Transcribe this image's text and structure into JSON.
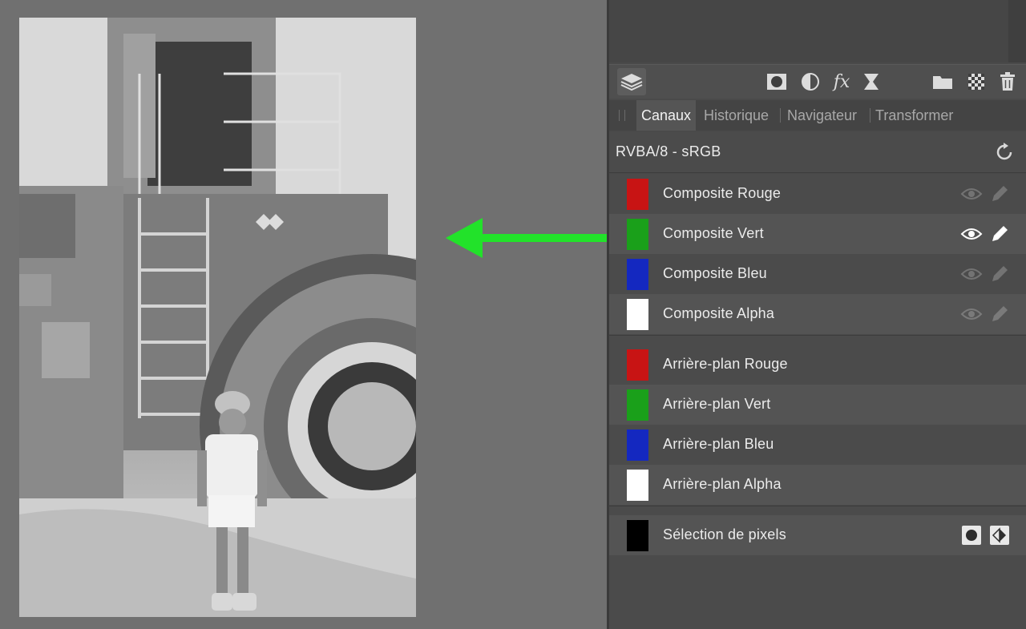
{
  "colors": {
    "accent_arrow": "#22e22a",
    "red_thumb": "#c81414",
    "green_thumb": "#1aa01a",
    "blue_thumb": "#1428c0",
    "alpha_thumb": "#ffffff",
    "selection_thumb": "#000000"
  },
  "toolbar": {
    "icons": [
      "layers-icon",
      "mask-icon",
      "adjustment-icon",
      "fx-icon",
      "live-filter-icon",
      "folder-icon",
      "checkerboard-icon",
      "trash-icon"
    ],
    "fx_label": "fx"
  },
  "tabs": [
    {
      "label": "Canaux",
      "active": true
    },
    {
      "label": "Historique",
      "active": false
    },
    {
      "label": "Navigateur",
      "active": false
    },
    {
      "label": "Transformer",
      "active": false
    }
  ],
  "format": {
    "label": "RVBA/8 - sRGB"
  },
  "composite_channels": [
    {
      "label": "Composite Rouge",
      "color": "red",
      "visible_highlighted": false
    },
    {
      "label": "Composite Vert",
      "color": "green",
      "visible_highlighted": true
    },
    {
      "label": "Composite Bleu",
      "color": "blue",
      "visible_highlighted": false
    },
    {
      "label": "Composite Alpha",
      "color": "alpha",
      "visible_highlighted": false
    }
  ],
  "background_channels": [
    {
      "label": "Arrière-plan Rouge",
      "color": "red"
    },
    {
      "label": "Arrière-plan Vert",
      "color": "green"
    },
    {
      "label": "Arrière-plan Bleu",
      "color": "blue"
    },
    {
      "label": "Arrière-plan Alpha",
      "color": "alpha"
    }
  ],
  "selection": {
    "label": "Sélection de pixels"
  }
}
